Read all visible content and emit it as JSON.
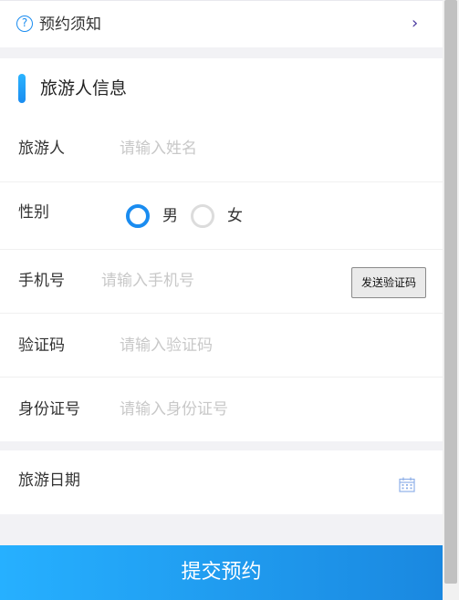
{
  "notice": {
    "icon": "question-circle-icon",
    "icon_glyph": "?",
    "label": "预约须知",
    "chevron": "›"
  },
  "traveler": {
    "section_title": "旅游人信息",
    "name": {
      "label": "旅游人",
      "placeholder": "请输入姓名"
    },
    "gender": {
      "label": "性别",
      "options": [
        "男",
        "女"
      ],
      "selected": "男"
    },
    "phone": {
      "label": "手机号",
      "placeholder": "请输入手机号",
      "send_code_label": "发送验证码"
    },
    "code": {
      "label": "验证码",
      "placeholder": "请输入验证码"
    },
    "id_card": {
      "label": "身份证号",
      "placeholder": "请输入身份证号"
    }
  },
  "travel_date": {
    "label": "旅游日期",
    "icon": "calendar-icon"
  },
  "submit_label": "提交预约",
  "colors": {
    "accent": "#1a8cf0",
    "background": "#f2f2f5"
  }
}
